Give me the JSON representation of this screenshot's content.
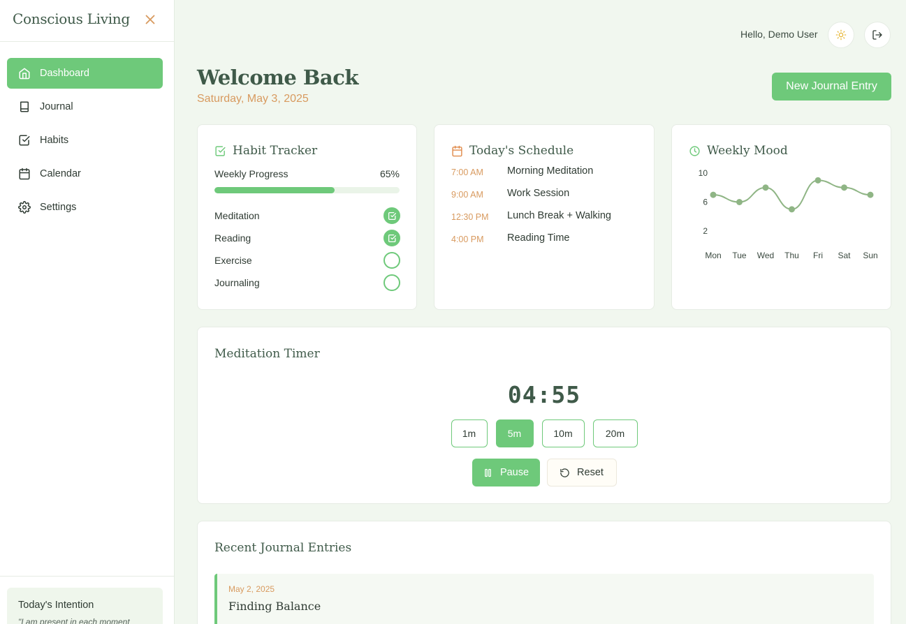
{
  "app": {
    "brand": "Conscious Living"
  },
  "sidebar": {
    "items": [
      {
        "label": "Dashboard",
        "icon": "home-icon",
        "active": true
      },
      {
        "label": "Journal",
        "icon": "book-icon",
        "active": false
      },
      {
        "label": "Habits",
        "icon": "check-square-icon",
        "active": false
      },
      {
        "label": "Calendar",
        "icon": "calendar-icon",
        "active": false
      },
      {
        "label": "Settings",
        "icon": "gear-icon",
        "active": false
      }
    ],
    "intention": {
      "title": "Today's Intention",
      "text": "\"I am present in each moment"
    }
  },
  "topbar": {
    "greeting": "Hello, Demo User"
  },
  "header": {
    "title": "Welcome Back",
    "date": "Saturday, May 3, 2025",
    "new_entry_label": "New Journal Entry"
  },
  "habit_tracker": {
    "title": "Habit Tracker",
    "progress_label": "Weekly Progress",
    "progress_value": "65%",
    "progress_fraction": 0.65,
    "habits": [
      {
        "name": "Meditation",
        "done": true
      },
      {
        "name": "Reading",
        "done": true
      },
      {
        "name": "Exercise",
        "done": false
      },
      {
        "name": "Journaling",
        "done": false
      }
    ]
  },
  "schedule": {
    "title": "Today's Schedule",
    "items": [
      {
        "time": "7:00 AM",
        "activity": "Morning Meditation"
      },
      {
        "time": "9:00 AM",
        "activity": "Work Session"
      },
      {
        "time": "12:30 PM",
        "activity": "Lunch Break + Walking"
      },
      {
        "time": "4:00 PM",
        "activity": "Reading Time"
      }
    ]
  },
  "mood": {
    "title": "Weekly Mood"
  },
  "chart_data": {
    "type": "line",
    "title": "Weekly Mood",
    "categories": [
      "Mon",
      "Tue",
      "Wed",
      "Thu",
      "Fri",
      "Sat",
      "Sun"
    ],
    "values": [
      7,
      6,
      8,
      5,
      9,
      8,
      7
    ],
    "yticks": [
      10,
      6,
      2
    ],
    "ylim": [
      2,
      10
    ],
    "grid": false,
    "color": "#8fb585"
  },
  "timer": {
    "title": "Meditation Timer",
    "display": "04:55",
    "presets": [
      {
        "label": "1m",
        "active": false
      },
      {
        "label": "5m",
        "active": true
      },
      {
        "label": "10m",
        "active": false
      },
      {
        "label": "20m",
        "active": false
      }
    ],
    "pause_label": "Pause",
    "reset_label": "Reset"
  },
  "journal": {
    "title": "Recent Journal Entries",
    "entries": [
      {
        "date": "May 2, 2025",
        "title": "Finding Balance"
      }
    ]
  },
  "colors": {
    "accent": "#6ec97a",
    "secondary": "#d89a5f",
    "background": "#f1f7ef",
    "heading": "#3f5a49"
  }
}
